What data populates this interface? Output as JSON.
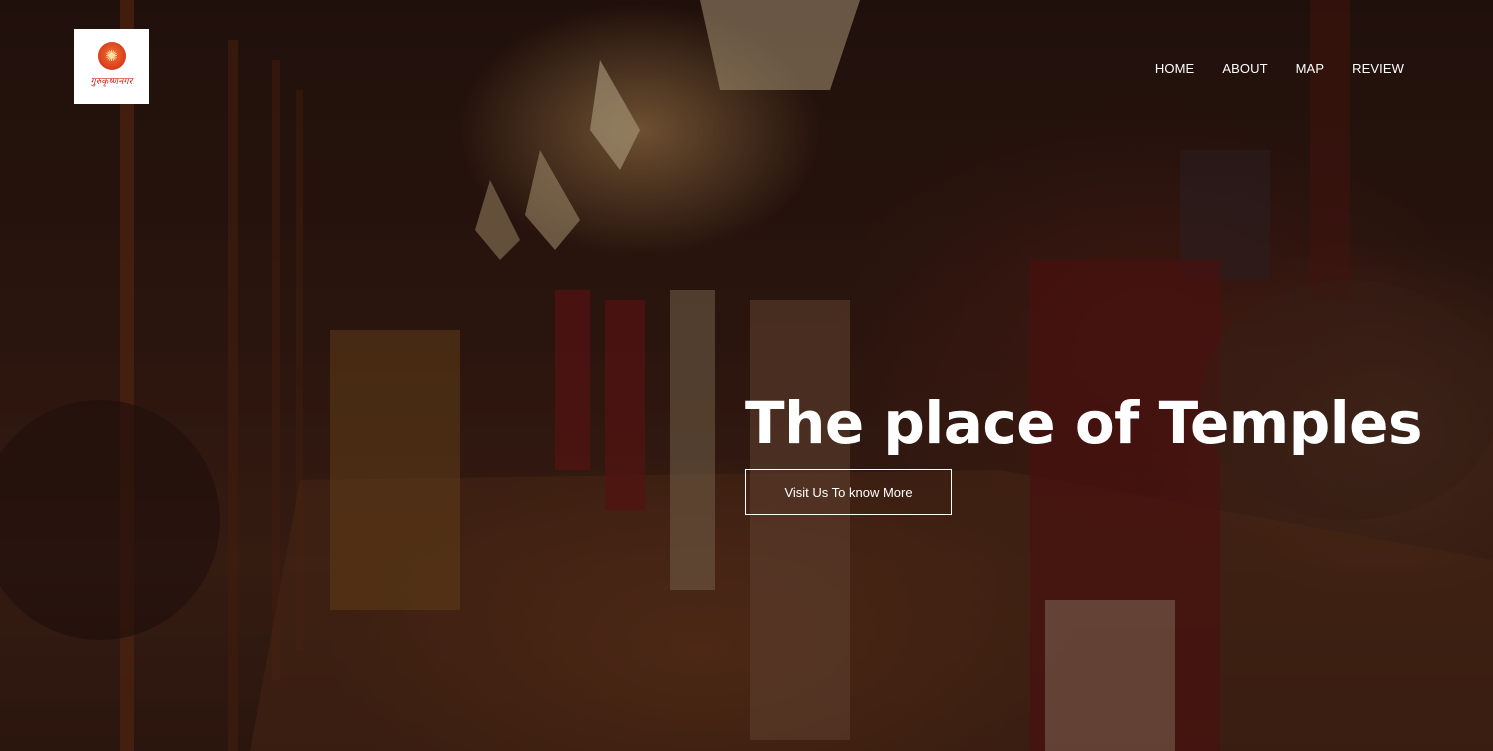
{
  "logo": {
    "text": "गुरुकृष्णनगर",
    "emblem_glyph": "✺",
    "icon": "temple-emblem-icon"
  },
  "nav": {
    "items": [
      {
        "label": "HOME"
      },
      {
        "label": "ABOUT"
      },
      {
        "label": "MAP"
      },
      {
        "label": "REVIEW"
      }
    ]
  },
  "hero": {
    "headline": "The place of Temples",
    "cta_label": "Visit Us To know More",
    "background": "aarti-ceremony-photo"
  },
  "colors": {
    "text": "#ffffff",
    "logo_red": "#c4261b",
    "overlay": "rgba(15,5,3,0.35)"
  }
}
